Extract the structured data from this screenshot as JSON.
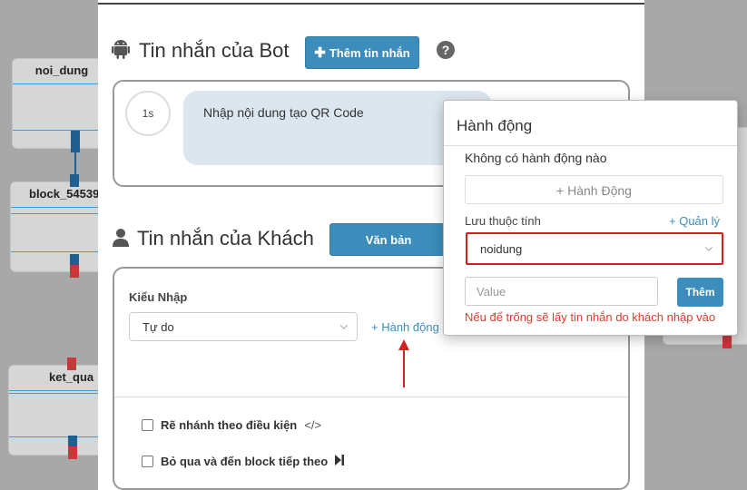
{
  "canvas": {
    "nodes": [
      {
        "title": "noi_dung"
      },
      {
        "title": "block_54539"
      },
      {
        "title": "ket_qua"
      }
    ]
  },
  "bot_section": {
    "title": "Tin nhắn của Bot",
    "add_button": "Thêm tin nhắn",
    "help": "?",
    "delay": "1s",
    "message": "Nhập nội dung tạo QR Code"
  },
  "guest_section": {
    "title": "Tin nhắn của Khách",
    "type_button": "Văn bản",
    "input_type_label": "Kiểu Nhập",
    "input_type_value": "Tự do",
    "action_link": "+ Hành động",
    "branch_label": "Rẽ nhánh theo điều kiện",
    "branch_icon": "</>",
    "skip_label": "Bỏ qua và đến block tiếp theo"
  },
  "popup": {
    "title": "Hành động",
    "no_action": "Không có hành động nào",
    "add_action": "+ Hành Động",
    "save_attr_label": "Lưu thuộc tính",
    "manage_link": "+ Quản lý",
    "attr_value": "noidung",
    "value_placeholder": "Value",
    "add_button": "Thêm",
    "hint": "Nếu để trống sẽ lấy tin nhắn do khách nhập vào"
  },
  "colors": {
    "accent": "#3c8dbc",
    "highlight": "#d62020",
    "bubble": "#dce6ef",
    "port_blue": "#1f5f91",
    "port_red": "#c9373b"
  }
}
